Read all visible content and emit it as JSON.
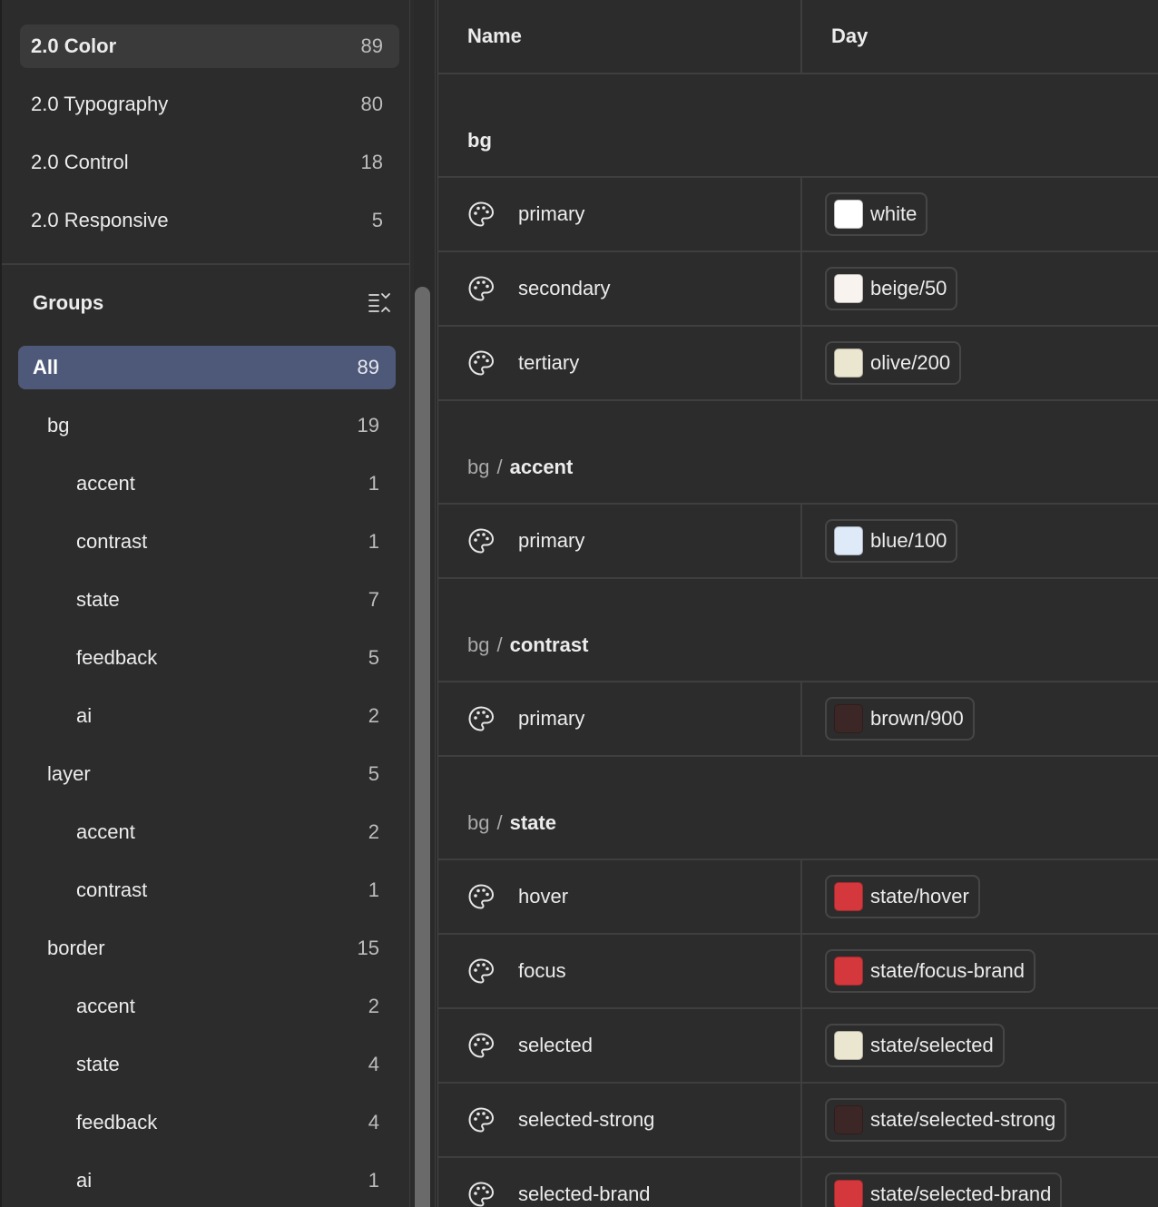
{
  "collections": [
    {
      "label": "2.0 Color",
      "count": "89",
      "active": true
    },
    {
      "label": "2.0 Typography",
      "count": "80"
    },
    {
      "label": "2.0 Control",
      "count": "18"
    },
    {
      "label": "2.0 Responsive",
      "count": "5"
    }
  ],
  "groups": {
    "title": "Groups",
    "collapse_icon": "collapse-all-icon",
    "items": [
      {
        "label": "All",
        "count": "89",
        "level": 0,
        "active": true
      },
      {
        "label": "bg",
        "count": "19",
        "level": 1
      },
      {
        "label": "accent",
        "count": "1",
        "level": 2
      },
      {
        "label": "contrast",
        "count": "1",
        "level": 2
      },
      {
        "label": "state",
        "count": "7",
        "level": 2
      },
      {
        "label": "feedback",
        "count": "5",
        "level": 2
      },
      {
        "label": "ai",
        "count": "2",
        "level": 2
      },
      {
        "label": "layer",
        "count": "5",
        "level": 1
      },
      {
        "label": "accent",
        "count": "2",
        "level": 2
      },
      {
        "label": "contrast",
        "count": "1",
        "level": 2
      },
      {
        "label": "border",
        "count": "15",
        "level": 1
      },
      {
        "label": "accent",
        "count": "2",
        "level": 2
      },
      {
        "label": "state",
        "count": "4",
        "level": 2
      },
      {
        "label": "feedback",
        "count": "4",
        "level": 2
      },
      {
        "label": "ai",
        "count": "1",
        "level": 2
      }
    ]
  },
  "table": {
    "columns": {
      "name": "Name",
      "day": "Day"
    },
    "row_icon": "palette-icon",
    "rows": [
      {
        "kind": "group",
        "parent": "",
        "sep": "",
        "leaf": "bg"
      },
      {
        "kind": "var",
        "name": "primary",
        "value": "white",
        "swatch": "#ffffff"
      },
      {
        "kind": "var",
        "name": "secondary",
        "value": "beige/50",
        "swatch": "#f8f3ef"
      },
      {
        "kind": "var",
        "name": "tertiary",
        "value": "olive/200",
        "swatch": "#ebe6cf"
      },
      {
        "kind": "group",
        "parent": "bg",
        "sep": "/",
        "leaf": "accent"
      },
      {
        "kind": "var",
        "name": "primary",
        "value": "blue/100",
        "swatch": "#dfeaf8"
      },
      {
        "kind": "group",
        "parent": "bg",
        "sep": "/",
        "leaf": "contrast"
      },
      {
        "kind": "var",
        "name": "primary",
        "value": "brown/900",
        "swatch": "#3d2726"
      },
      {
        "kind": "group",
        "parent": "bg",
        "sep": "/",
        "leaf": "state"
      },
      {
        "kind": "var",
        "name": "hover",
        "value": "state/hover",
        "swatch": "#d5383c"
      },
      {
        "kind": "var",
        "name": "focus",
        "value": "state/focus-brand",
        "swatch": "#d5383c"
      },
      {
        "kind": "var",
        "name": "selected",
        "value": "state/selected",
        "swatch": "#ebe6cf"
      },
      {
        "kind": "var",
        "name": "selected-strong",
        "value": "state/selected-strong",
        "swatch": "#3d2726"
      },
      {
        "kind": "var",
        "name": "selected-brand",
        "value": "state/selected-brand",
        "swatch": "#d5383c"
      }
    ]
  }
}
